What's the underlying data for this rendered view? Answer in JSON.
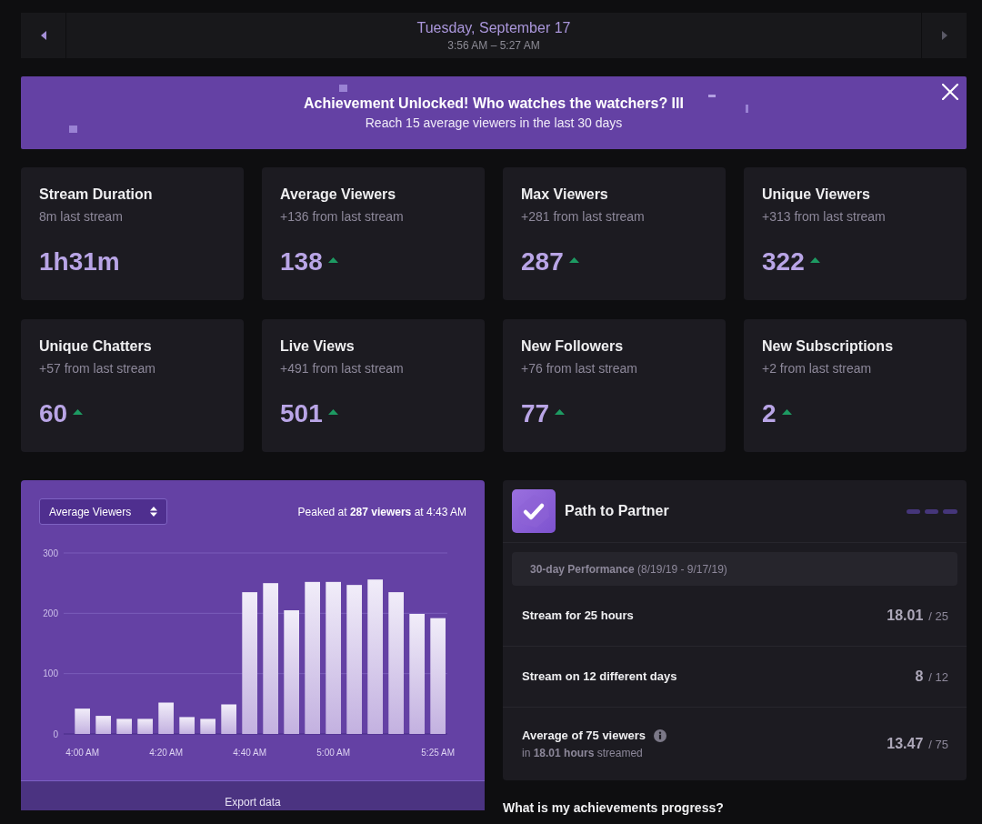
{
  "date_nav": {
    "date": "Tuesday, September 17",
    "time_range": "3:56 AM – 5:27 AM",
    "prev_disabled": false,
    "next_disabled": true
  },
  "achievement_banner": {
    "title": "Achievement Unlocked! Who watches the watchers? III",
    "description": "Reach 15 average viewers in the last 30 days"
  },
  "stats": [
    {
      "label": "Stream Duration",
      "change": "8m last stream",
      "value": "1h31m",
      "trend_up": false
    },
    {
      "label": "Average Viewers",
      "change": "+136 from last stream",
      "value": "138",
      "trend_up": true
    },
    {
      "label": "Max Viewers",
      "change": "+281 from last stream",
      "value": "287",
      "trend_up": true
    },
    {
      "label": "Unique Viewers",
      "change": "+313 from last stream",
      "value": "322",
      "trend_up": true
    },
    {
      "label": "Unique Chatters",
      "change": "+57 from last stream",
      "value": "60",
      "trend_up": true
    },
    {
      "label": "Live Views",
      "change": "+491 from last stream",
      "value": "501",
      "trend_up": true
    },
    {
      "label": "New Followers",
      "change": "+76 from last stream",
      "value": "77",
      "trend_up": true
    },
    {
      "label": "New Subscriptions",
      "change": "+2 from last stream",
      "value": "2",
      "trend_up": true
    }
  ],
  "chart_panel": {
    "metric_select": "Average Viewers",
    "peak": "Peaked at **287 viewers** at 4:43 AM",
    "chart_data": {
      "type": "bar",
      "categories": [
        "4:00 AM",
        null,
        null,
        null,
        "4:20 AM",
        null,
        null,
        null,
        "4:40 AM",
        null,
        null,
        null,
        "5:00 AM",
        null,
        null,
        null,
        null,
        "5:25 AM"
      ],
      "values": [
        42,
        30,
        25,
        25,
        52,
        28,
        25,
        49,
        235,
        250,
        205,
        252,
        252,
        247,
        256,
        235,
        199,
        192
      ],
      "yticks": [
        0,
        100,
        200,
        300
      ],
      "ylim": [
        0,
        300
      ]
    },
    "export_button": "Export data"
  },
  "path_to_partner": {
    "title": "Path to Partner",
    "period": "**30-day Performance** (8/19/19 - 9/17/19)",
    "goals": [
      {
        "label": "Stream for 25 hours",
        "current": "18.01",
        "target": "/ 25",
        "has_info": false
      },
      {
        "label": "Stream on 12 different days",
        "current": "8",
        "target": "/ 12",
        "has_info": false
      },
      {
        "label": "Average of 75 viewers",
        "note": "in **18.01 hours** streamed",
        "current": "13.47",
        "target": "/ 75",
        "has_info": true
      }
    ]
  },
  "faq_heading": "What is my achievements progress?"
}
